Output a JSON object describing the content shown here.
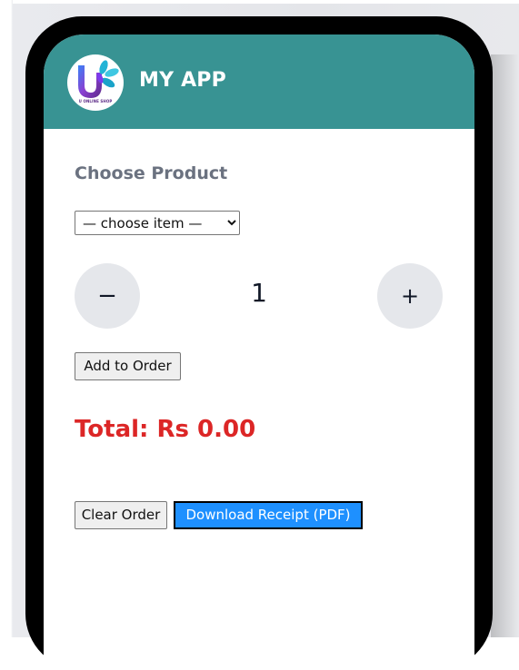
{
  "app": {
    "title": "MY APP",
    "logo_text": "U ONLINE SHOP"
  },
  "form": {
    "section_label": "Choose Product",
    "select_options": [
      "— choose item —"
    ],
    "selected_value": "— choose item —",
    "quantity": "1",
    "minus_label": "−",
    "plus_label": "+",
    "add_label": "Add to Order"
  },
  "summary": {
    "total_label": "Total: Rs 0.00"
  },
  "actions": {
    "clear_label": "Clear Order",
    "download_label": "Download Receipt (PDF)"
  },
  "colors": {
    "header": "#389393",
    "total": "#dc2626",
    "download_bg": "#1e90ff",
    "qty_button_bg": "#e5e7eb"
  },
  "icons": {
    "logo": "u-shop-logo-icon",
    "select_arrow": "chevron-down-icon"
  }
}
